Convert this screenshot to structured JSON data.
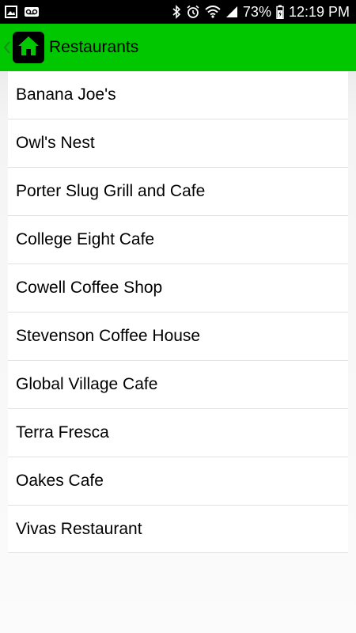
{
  "status_bar": {
    "battery": "73%",
    "time": "12:19 PM",
    "left_icons": [
      "image-icon",
      "voicemail-icon"
    ],
    "right_icons": [
      "bluetooth-icon",
      "alarm-icon",
      "wifi-icon",
      "signal-icon",
      "battery-icon"
    ]
  },
  "app_bar": {
    "title": "Restaurants",
    "color": "#00c700"
  },
  "restaurants": [
    {
      "name": "Banana Joe's"
    },
    {
      "name": "Owl's Nest"
    },
    {
      "name": "Porter Slug Grill and Cafe"
    },
    {
      "name": "College Eight Cafe"
    },
    {
      "name": "Cowell Coffee Shop"
    },
    {
      "name": "Stevenson Coffee House"
    },
    {
      "name": "Global Village Cafe"
    },
    {
      "name": "Terra Fresca"
    },
    {
      "name": "Oakes Cafe"
    },
    {
      "name": "Vivas Restaurant"
    }
  ]
}
